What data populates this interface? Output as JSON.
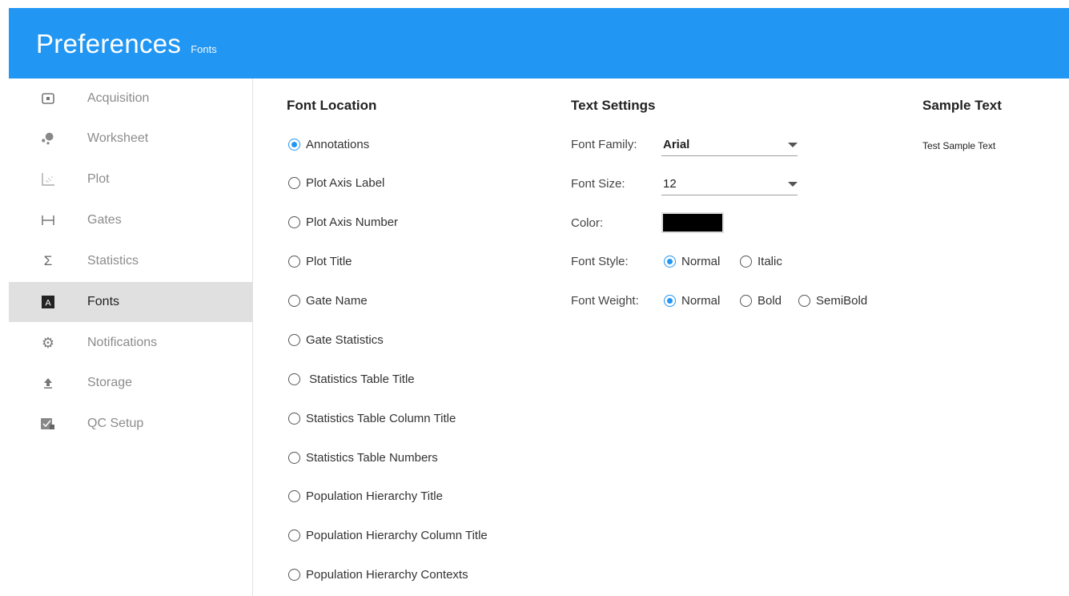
{
  "header": {
    "title": "Preferences",
    "subtitle": "Fonts"
  },
  "sidebar": {
    "items": [
      {
        "label": "Acquisition",
        "icon": "acquisition-icon"
      },
      {
        "label": "Worksheet",
        "icon": "worksheet-icon"
      },
      {
        "label": "Plot",
        "icon": "plot-icon"
      },
      {
        "label": "Gates",
        "icon": "gates-icon"
      },
      {
        "label": "Statistics",
        "icon": "sigma-icon"
      },
      {
        "label": "Fonts",
        "icon": "font-icon",
        "active": true
      },
      {
        "label": "Notifications",
        "icon": "gear-icon"
      },
      {
        "label": "Storage",
        "icon": "upload-icon"
      },
      {
        "label": "QC Setup",
        "icon": "qc-setup-icon"
      }
    ]
  },
  "font_location": {
    "title": "Font Location",
    "selected": "Annotations",
    "options": [
      "Annotations",
      "Plot Axis Label",
      "Plot Axis Number",
      "Plot Title",
      "Gate Name",
      "Gate Statistics",
      " Statistics Table Title",
      "Statistics Table Column Title",
      "Statistics Table Numbers",
      "Population Hierarchy Title",
      "Population Hierarchy Column Title",
      "Population Hierarchy Contexts"
    ]
  },
  "text_settings": {
    "title": "Text Settings",
    "font_family_label": "Font Family:",
    "font_family_value": "Arial",
    "font_size_label": "Font Size:",
    "font_size_value": "12",
    "color_label": "Color:",
    "color_value": "#000000",
    "font_style_label": "Font Style:",
    "font_style_options": [
      "Normal",
      "Italic"
    ],
    "font_style_selected": "Normal",
    "font_weight_label": "Font Weight:",
    "font_weight_options": [
      "Normal",
      "Bold",
      "SemiBold"
    ],
    "font_weight_selected": "Normal"
  },
  "sample": {
    "title": "Sample Text",
    "text": "Test Sample Text"
  },
  "colors": {
    "accent": "#2196f3",
    "active_nav": "#e0e0e0"
  }
}
